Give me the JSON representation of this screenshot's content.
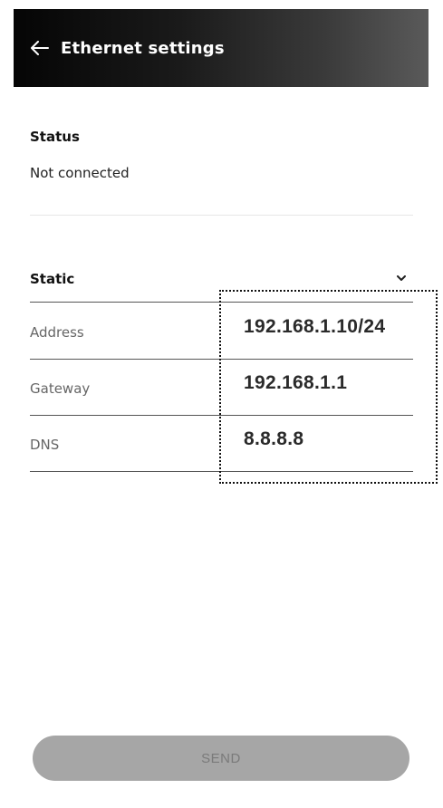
{
  "header": {
    "title": "Ethernet settings",
    "back_icon": "arrow-left-icon"
  },
  "status": {
    "heading": "Status",
    "value": "Not connected"
  },
  "ip_config": {
    "mode_label": "Static",
    "mode_icon": "chevron-down-icon",
    "fields": [
      {
        "label": "Address",
        "value": "192.168.1.10/24"
      },
      {
        "label": "Gateway",
        "value": "192.168.1.1"
      },
      {
        "label": "DNS",
        "value": "8.8.8.8"
      }
    ]
  },
  "actions": {
    "send_label": "SEND"
  },
  "colors": {
    "header_start": "#050505",
    "header_end": "#5a5a5a",
    "button_disabled": "#a6a6a6"
  }
}
